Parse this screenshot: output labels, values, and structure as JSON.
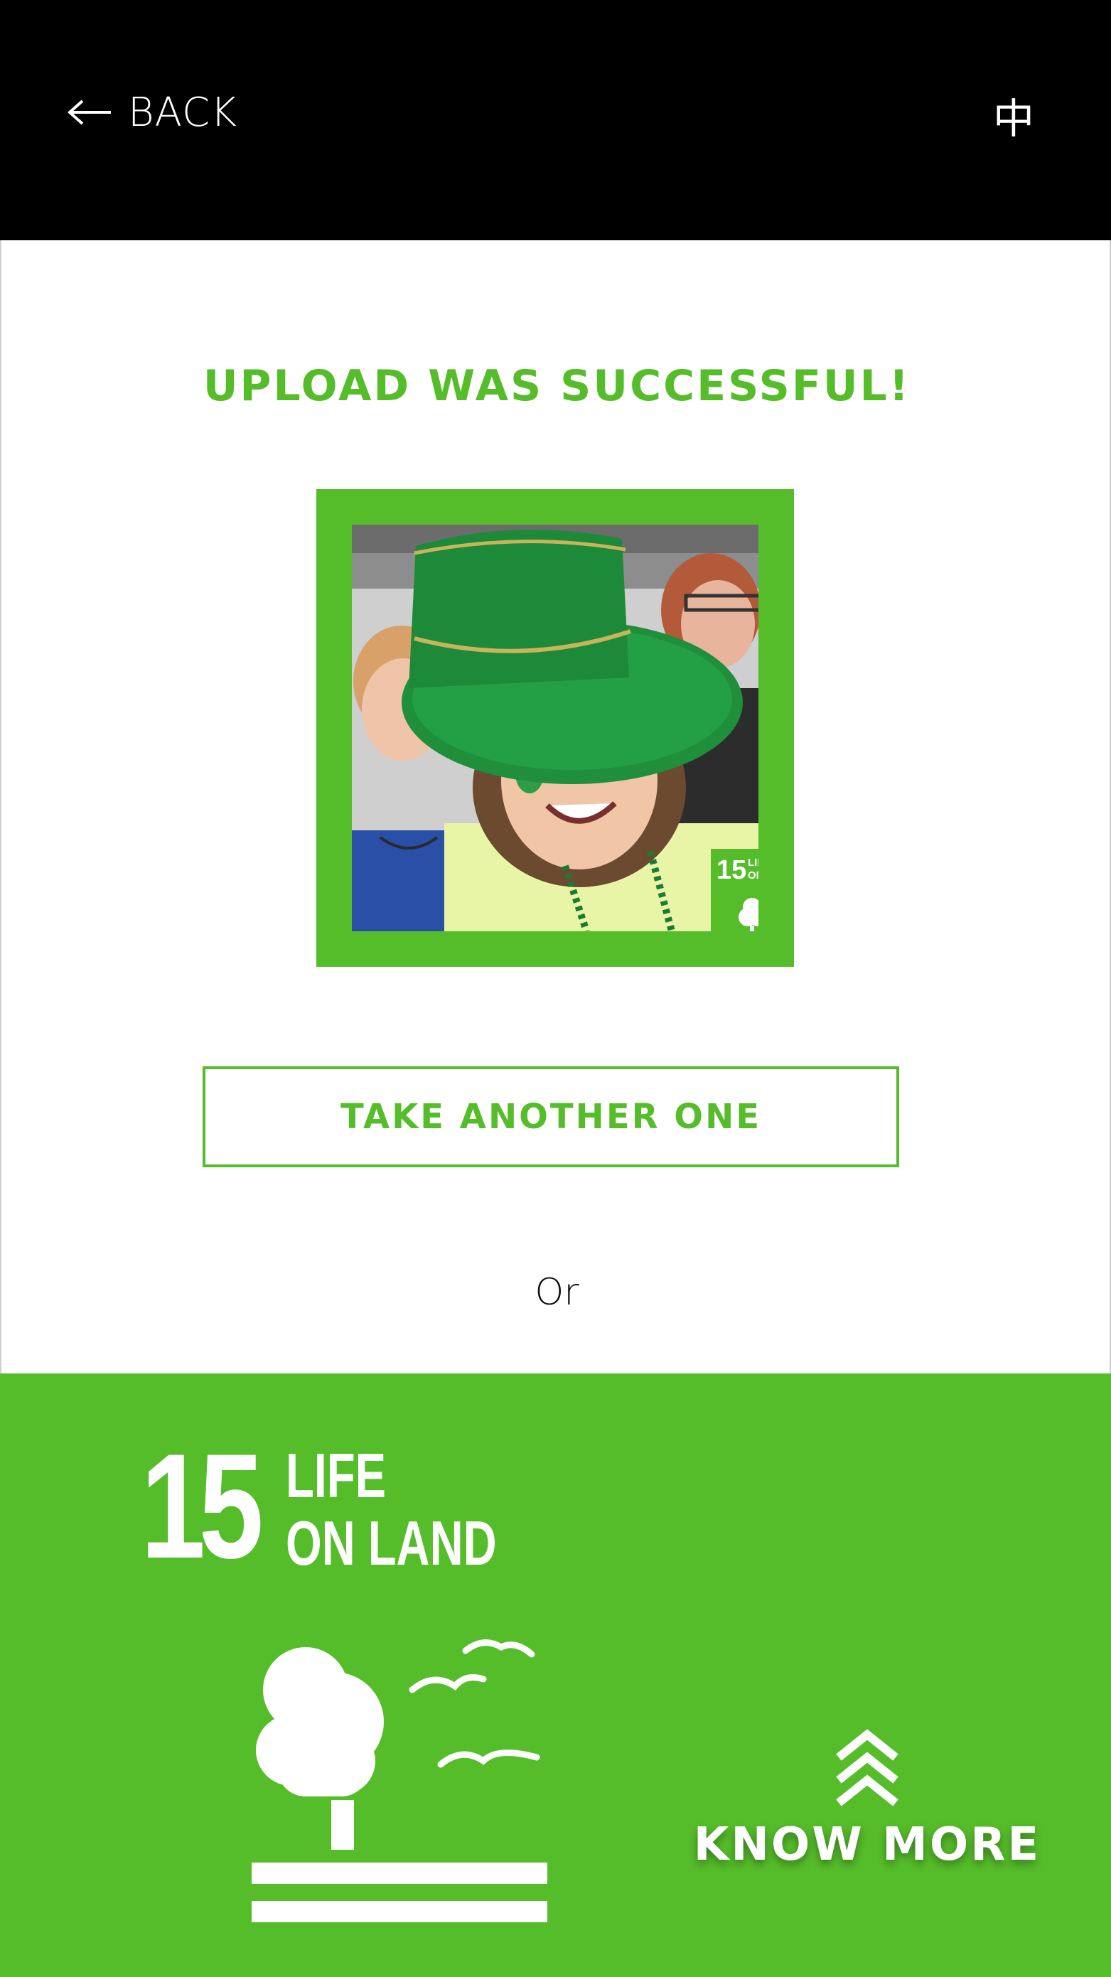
{
  "header": {
    "back_label": "BACK",
    "language_label": "中",
    "back_icon": "left-arrow-icon"
  },
  "main": {
    "title": "UPLOAD WAS SUCCESSFUL!",
    "photo": {
      "description_icon": "selfie-photo-image",
      "badge_number": "15",
      "badge_line1": "LIFE",
      "badge_line2": "ON LAND"
    },
    "take_another_label": "TAKE ANOTHER ONE",
    "or_label": "Or"
  },
  "sdg": {
    "number": "15",
    "name_line1": "LIFE",
    "name_line2": "ON LAND",
    "icon": "tree-and-birds-icon",
    "know_more_label": "KNOW MORE",
    "know_more_icon": "double-chevron-up-icon"
  },
  "colors": {
    "accent": "#56bd2a",
    "header_bg": "#000000",
    "background": "#ffffff"
  }
}
